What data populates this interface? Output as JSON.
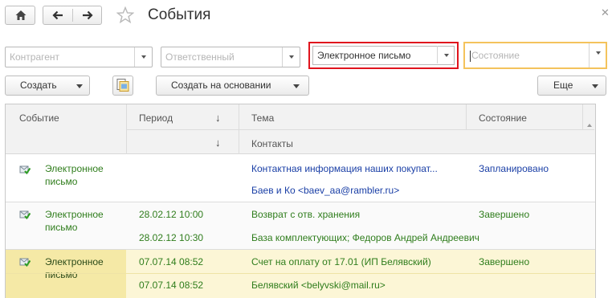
{
  "window": {
    "title": "События",
    "close_icon": "close-icon",
    "favorite_icon": "star-icon"
  },
  "nav": {
    "home_icon": "home-icon",
    "back_icon": "arrow-left-icon",
    "forward_icon": "arrow-right-icon"
  },
  "filters": {
    "counterparty": {
      "placeholder": "Контрагент",
      "value": ""
    },
    "responsible": {
      "placeholder": "Ответственный",
      "value": ""
    },
    "event_type": {
      "value": "Электронное письмо"
    },
    "state": {
      "placeholder": "Состояние",
      "value": ""
    }
  },
  "toolbar": {
    "create_label": "Создать",
    "create_based_label": "Создать на основании",
    "more_label": "Еще"
  },
  "table": {
    "columns": {
      "event": "Событие",
      "period": "Период",
      "subject": "Тема",
      "contacts": "Контакты",
      "state": "Состояние"
    },
    "sort_indicator": "↓",
    "rows": [
      {
        "event": "Электронное\nписьмо",
        "period_start": "",
        "period_end": "",
        "subject": "Контактная информация наших покупат...",
        "contacts": "Баев и Ко <baev_aa@rambler.ru>",
        "state": "Запланировано",
        "status_color": "#1a3fa6"
      },
      {
        "event": "Электронное\nписьмо",
        "period_start": "28.02.12 10:00",
        "period_end": "28.02.12 10:30",
        "subject": "Возврат с отв. хранения",
        "contacts": "База комплектующих; Федоров Андрей Андреевич",
        "state": "Завершено",
        "status_color": "#2f7d1c"
      },
      {
        "event": "Электронное\nписьмо",
        "period_start": "07.07.14 08:52",
        "period_end": "07.07.14 08:52",
        "subject": "Счет на оплату от 17.01 (ИП Белявский)",
        "contacts": "Белявский <belyvski@mail.ru>",
        "state": "Завершено",
        "status_color": "#2f7d1c",
        "selected": true
      }
    ]
  },
  "colors": {
    "highlight_border": "#e0141d",
    "focus_border": "#f4c35c",
    "selected_row": "#f5e9a6",
    "planned_text": "#1a3fa6",
    "completed_text": "#2f7d1c"
  }
}
